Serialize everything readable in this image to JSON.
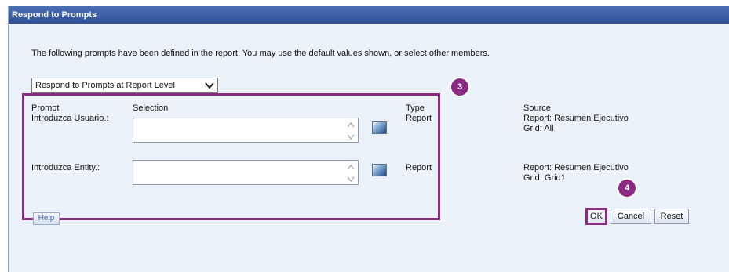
{
  "dialog": {
    "title": "Respond to Prompts",
    "intro_text": "The following prompts have been defined in the report. You may use the default values shown, or select other members.",
    "level_select": {
      "selected": "Respond to Prompts at Report Level"
    }
  },
  "table": {
    "headers": {
      "prompt": "Prompt",
      "selection": "Selection",
      "type": "Type",
      "source": "Source"
    },
    "rows": [
      {
        "prompt": "Introduzca Usuario.:",
        "selection": "",
        "type": "Report",
        "source_line1": "Report: Resumen Ejecutivo",
        "source_line2": "Grid: All"
      },
      {
        "prompt": "Introduzca Entity.:",
        "selection": "",
        "type": "Report",
        "source_line1": "Report: Resumen Ejecutivo",
        "source_line2": "Grid: Grid1"
      }
    ]
  },
  "buttons": {
    "help": "Help",
    "ok": "OK",
    "cancel": "Cancel",
    "reset": "Reset"
  },
  "callouts": {
    "badge_a": "3",
    "badge_b": "4"
  },
  "colors": {
    "callout": "#8b2a83",
    "titlebar": "#3a5a9e",
    "panel": "#ecf2f9"
  },
  "icons": {
    "dropdown": "chevron-down-icon",
    "member_select": "member-selector-icon",
    "spinner": "spin-arrows-icon"
  }
}
